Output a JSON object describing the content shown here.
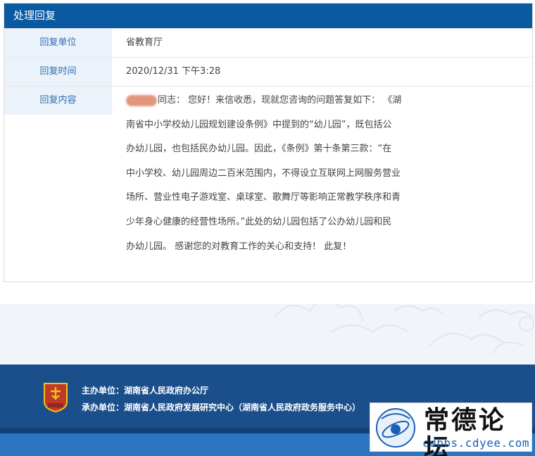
{
  "panel": {
    "header_title": "处理回复",
    "rows": [
      {
        "label": "回复单位",
        "value": "省教育厅"
      },
      {
        "label": "回复时间",
        "value": "2020/12/31 下午3:28"
      },
      {
        "label": "回复内容",
        "value_lines": [
          "同志： 您好！来信收悉，现就您咨询的问题答复如下： 《湖",
          "南省中小学校幼儿园规划建设条例》中提到的“幼儿园”，既包括公",
          "办幼儿园，也包括民办幼儿园。因此，《条例》第十条第三款：“在",
          "中小学校、幼儿园周边二百米范围内，不得设立互联网上网服务营业",
          "场所、营业性电子游戏室、桌球室、歌舞厅等影响正常教学秩序和青",
          "少年身心健康的经营性场所。”此处的幼儿园包括了公办幼儿园和民",
          "办幼儿园。 感谢您的对教育工作的关心和支持！ 此复！"
        ]
      }
    ]
  },
  "footer": {
    "sponsor_label": "主办单位：",
    "sponsor_value": "湖南省人民政府办公厅",
    "organizer_label": "承办单位：",
    "organizer_value": "湖南省人民政府发展研究中心（湖南省人民政府政务服务中心）",
    "emblem_icon": "government-emblem-icon"
  },
  "watermark": {
    "title": "常德论坛",
    "url": "cdbbs.cdyee.com",
    "logo_icon": "forum-logo-icon"
  },
  "colors": {
    "header_blue": "#0b5aa1",
    "label_text": "#2f6db2",
    "label_bg": "#ecf2fa",
    "footer_bg": "#1b4f8c"
  }
}
